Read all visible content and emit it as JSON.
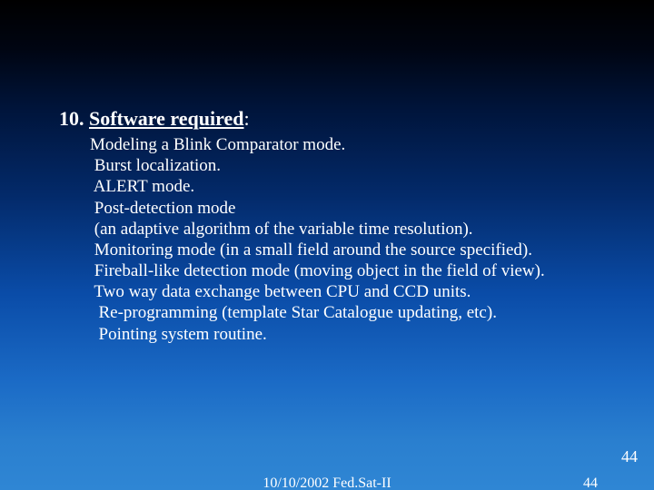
{
  "heading": {
    "number": "10.",
    "title": "Software required",
    "suffix": ":"
  },
  "lines": {
    "l0": "Modeling a Blink Comparator mode.",
    "l1": " Burst localization.",
    "l2": " ALERT mode.",
    "l3": " Post-detection mode",
    "l4": " (an adaptive algorithm of the variable time resolution).",
    "l5": " Monitoring mode (in a small field around the source specified).",
    "l6": " Fireball-like detection mode (moving object in the field of view).",
    "l7": " Two way data exchange between CPU and CCD units.",
    "l8": "  Re-programming (template Star Catalogue updating, etc).",
    "l9": "  Pointing system routine."
  },
  "footer": {
    "date": "10/10/2002 Fed.Sat-II",
    "page_inner": "44",
    "page_outer": "44"
  }
}
